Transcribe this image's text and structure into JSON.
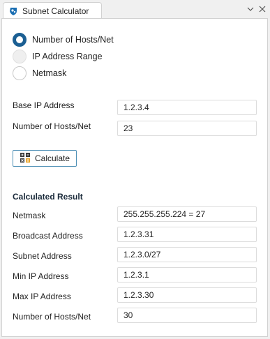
{
  "tab": {
    "title": "Subnet Calculator"
  },
  "mode": {
    "options": [
      {
        "label": "Number of Hosts/Net",
        "checked": true
      },
      {
        "label": "IP Address Range",
        "checked": false
      },
      {
        "label": "Netmask",
        "checked": false
      }
    ]
  },
  "input": {
    "base_ip_label": "Base IP Address",
    "base_ip_value": "1.2.3.4",
    "hosts_label": "Number of Hosts/Net",
    "hosts_value": "23"
  },
  "calculate_label": "Calculate",
  "result": {
    "title": "Calculated Result",
    "rows": [
      {
        "label": "Netmask",
        "value": "255.255.255.224 = 27"
      },
      {
        "label": "Broadcast Address",
        "value": "1.2.3.31"
      },
      {
        "label": "Subnet Address",
        "value": "1.2.3.0/27"
      },
      {
        "label": "Min IP Address",
        "value": "1.2.3.1"
      },
      {
        "label": "Max IP Address",
        "value": "1.2.3.30"
      },
      {
        "label": "Number of Hosts/Net",
        "value": "30"
      }
    ]
  },
  "colors": {
    "accent": "#1b5f93",
    "button_border": "#4d8fb5",
    "panel_border": "#d2d2d2"
  }
}
